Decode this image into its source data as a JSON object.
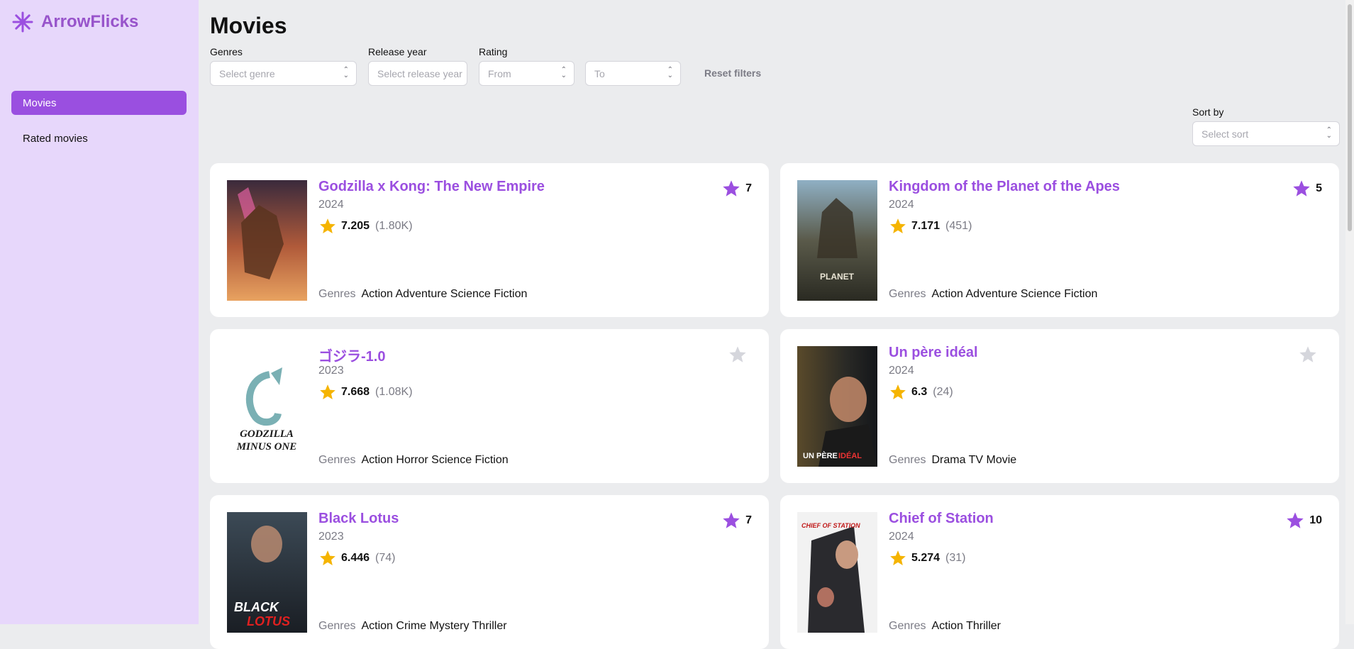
{
  "app": {
    "name": "ArrowFlicks",
    "logo_icon": "asterisk-logo-icon",
    "accent": "#9b4fe0"
  },
  "sidebar": {
    "items": [
      {
        "label": "Movies",
        "active": true
      },
      {
        "label": "Rated movies",
        "active": false
      }
    ]
  },
  "page": {
    "title": "Movies"
  },
  "filters": {
    "genres": {
      "label": "Genres",
      "placeholder": "Select genre"
    },
    "release_year": {
      "label": "Release year",
      "placeholder": "Select release year"
    },
    "rating": {
      "label": "Rating",
      "from_placeholder": "From",
      "to_placeholder": "To"
    },
    "reset_label": "Reset filters"
  },
  "sort": {
    "label": "Sort by",
    "placeholder": "Select sort"
  },
  "movies": [
    {
      "title": "Godzilla x Kong: The New Empire",
      "year": "2024",
      "rating": "7.205",
      "votes": "(1.80K)",
      "genres_label": "Genres",
      "genres": "Action Adventure Science Fiction",
      "user_rating": "7",
      "rated": true
    },
    {
      "title": "Kingdom of the Planet of the Apes",
      "year": "2024",
      "rating": "7.171",
      "votes": "(451)",
      "genres_label": "Genres",
      "genres": "Action Adventure Science Fiction",
      "user_rating": "5",
      "rated": true
    },
    {
      "title": "ゴジラ-1.0",
      "year": "2023",
      "rating": "7.668",
      "votes": "(1.08K)",
      "genres_label": "Genres",
      "genres": "Action Horror Science Fiction",
      "user_rating": "",
      "rated": false,
      "poster_text": [
        "GODZILLA",
        "MINUS ONE"
      ]
    },
    {
      "title": "Un père idéal",
      "year": "2024",
      "rating": "6.3",
      "votes": "(24)",
      "genres_label": "Genres",
      "genres": "Drama TV Movie",
      "user_rating": "",
      "rated": false,
      "poster_text": [
        "UN PÈRE",
        "IDÉAL"
      ]
    },
    {
      "title": "Black Lotus",
      "year": "2023",
      "rating": "6.446",
      "votes": "(74)",
      "genres_label": "Genres",
      "genres": "Action Crime Mystery Thriller",
      "user_rating": "7",
      "rated": true,
      "poster_text": [
        "BLACK",
        "LOTUS"
      ]
    },
    {
      "title": "Chief of Station",
      "year": "2024",
      "rating": "5.274",
      "votes": "(31)",
      "genres_label": "Genres",
      "genres": "Action Thriller",
      "user_rating": "10",
      "rated": true,
      "poster_text": [
        "CHIEF OF STATION"
      ]
    }
  ],
  "colors": {
    "sidebar_bg": "#e7d7fb",
    "active_nav": "#9a4fe0",
    "star_gold": "#f5b400",
    "star_purple": "#9b4fe0",
    "star_empty": "#d5d6dc",
    "page_bg": "#ebecee"
  }
}
